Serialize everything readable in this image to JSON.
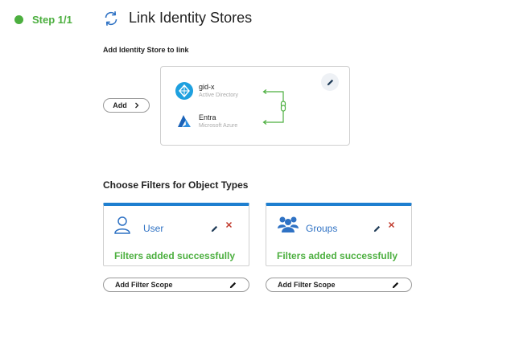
{
  "step": {
    "label": "Step 1/1"
  },
  "page": {
    "title": "Link Identity Stores"
  },
  "stores": {
    "subtitle": "Add Identity Store to link",
    "add_label": "Add",
    "items": [
      {
        "name": "gid-x",
        "type": "Active Directory",
        "icon": "active-directory-icon"
      },
      {
        "name": "Entra",
        "type": "Microsoft Azure",
        "icon": "azure-icon"
      }
    ]
  },
  "filters": {
    "heading": "Choose Filters for Object Types",
    "cards": [
      {
        "title": "User",
        "status": "Filters added successfully",
        "icon": "user-icon",
        "scope_label": "Add Filter Scope"
      },
      {
        "title": "Groups",
        "status": "Filters added successfully",
        "icon": "groups-icon",
        "scope_label": "Add Filter Scope"
      }
    ]
  },
  "colors": {
    "accent": "#1e7fd0",
    "success": "#4caf3f",
    "danger": "#c0392b"
  }
}
